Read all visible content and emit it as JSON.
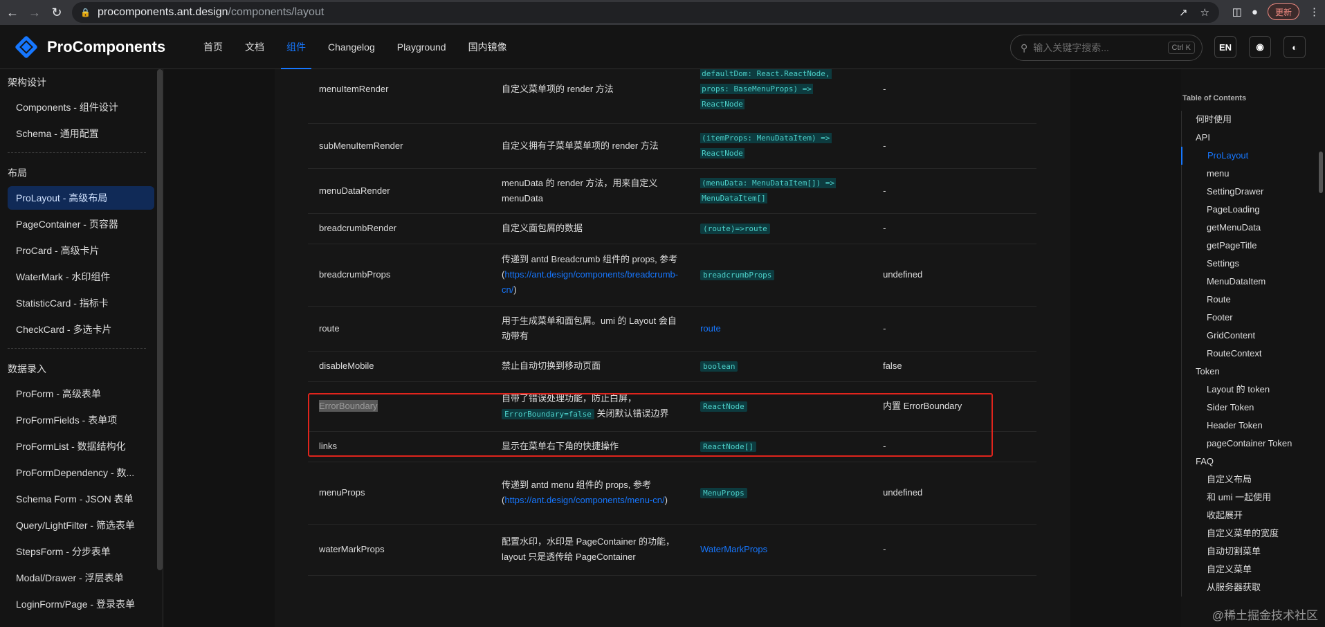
{
  "browser": {
    "url_host": "procomponents.ant.design",
    "url_path": "/components/layout",
    "update_label": "更新"
  },
  "header": {
    "logo_text": "ProComponents",
    "nav": [
      "首页",
      "文档",
      "组件",
      "Changelog",
      "Playground",
      "国内镜像"
    ],
    "active_nav": "组件",
    "search_placeholder": "输入关键字搜索...",
    "search_shortcut": "Ctrl K",
    "lang_label": "EN"
  },
  "sidebar": {
    "groups": [
      {
        "title": "架构设计",
        "items": [
          "Components - 组件设计",
          "Schema - 通用配置"
        ]
      },
      {
        "title": "布局",
        "items": [
          "ProLayout - 高级布局",
          "PageContainer - 页容器",
          "ProCard - 高级卡片",
          "WaterMark - 水印组件",
          "StatisticCard - 指标卡",
          "CheckCard - 多选卡片"
        ]
      },
      {
        "title": "数据录入",
        "items": [
          "ProForm - 高级表单",
          "ProFormFields - 表单项",
          "ProFormList - 数据结构化",
          "ProFormDependency - 数...",
          "Schema Form - JSON 表单",
          "Query/LightFilter - 筛选表单",
          "StepsForm - 分步表单",
          "Modal/Drawer - 浮层表单",
          "LoginForm/Page - 登录表单"
        ]
      }
    ],
    "active_item": "ProLayout - 高级布局"
  },
  "table": {
    "rows": [
      {
        "name": "menuItemRender",
        "desc": "自定义菜单项的 render 方法",
        "type": [
          "defaultDom: React.ReactNode,",
          "props: BaseMenuProps) =>",
          "ReactNode"
        ],
        "default": "-"
      },
      {
        "name": "subMenuItemRender",
        "desc": "自定义拥有子菜单菜单项的 render 方法",
        "type": [
          "(itemProps: MenuDataItem) =>",
          "ReactNode"
        ],
        "default": "-"
      },
      {
        "name": "menuDataRender",
        "desc": "menuData 的 render 方法，用来自定义 menuData",
        "type": [
          "(menuData: MenuDataItem[]) =>",
          "MenuDataItem[]"
        ],
        "default": "-"
      },
      {
        "name": "breadcrumbRender",
        "desc": "自定义面包屑的数据",
        "type_code": "(route)=>route",
        "default": "-"
      },
      {
        "name": "breadcrumbProps",
        "desc_pre": "传递到 antd Breadcrumb 组件的 props, 参考 (",
        "desc_link": "https://ant.design/components/breadcrumb-cn/",
        "desc_post": ")",
        "type_code": "breadcrumbProps",
        "default": "undefined"
      },
      {
        "name": "route",
        "desc": "用于生成菜单和面包屑。umi 的 Layout 会自动带有",
        "type_link": "route",
        "default": "-"
      },
      {
        "name": "disableMobile",
        "desc": "禁止自动切换到移动页面",
        "type_code": "boolean",
        "default": "false"
      },
      {
        "name": "ErrorBoundary",
        "desc_pre": "自带了错误处理功能，防止白屏，",
        "desc_code": "ErrorBoundary=false",
        "desc_post": " 关闭默认错误边界",
        "type_code": "ReactNode",
        "default": "内置 ErrorBoundary"
      },
      {
        "name": "links",
        "desc": "显示在菜单右下角的快捷操作",
        "type_code": "ReactNode[]",
        "default": "-"
      },
      {
        "name": "menuProps",
        "desc_pre": "传递到 antd menu 组件的 props, 参考 (",
        "desc_link": "https://ant.design/components/menu-cn/",
        "desc_post": ")",
        "type_code": "MenuProps",
        "default": "undefined"
      },
      {
        "name": "waterMarkProps",
        "desc": "配置水印，水印是 PageContainer 的功能，layout 只是透传给 PageContainer",
        "type_link": "WaterMarkProps",
        "default": "-"
      }
    ]
  },
  "toc": {
    "title": "Table of Contents",
    "items": [
      {
        "label": "何时使用",
        "level": 1
      },
      {
        "label": "API",
        "level": 1
      },
      {
        "label": "ProLayout",
        "level": 2,
        "active": true
      },
      {
        "label": "menu",
        "level": 2
      },
      {
        "label": "SettingDrawer",
        "level": 2
      },
      {
        "label": "PageLoading",
        "level": 2
      },
      {
        "label": "getMenuData",
        "level": 2
      },
      {
        "label": "getPageTitle",
        "level": 2
      },
      {
        "label": "Settings",
        "level": 2
      },
      {
        "label": "MenuDataItem",
        "level": 2
      },
      {
        "label": "Route",
        "level": 2
      },
      {
        "label": "Footer",
        "level": 2
      },
      {
        "label": "GridContent",
        "level": 2
      },
      {
        "label": "RouteContext",
        "level": 2
      },
      {
        "label": "Token",
        "level": 1
      },
      {
        "label": "Layout 的 token",
        "level": 2
      },
      {
        "label": "Sider Token",
        "level": 2
      },
      {
        "label": "Header Token",
        "level": 2
      },
      {
        "label": "pageContainer Token",
        "level": 2
      },
      {
        "label": "FAQ",
        "level": 1
      },
      {
        "label": "自定义布局",
        "level": 2
      },
      {
        "label": "和 umi 一起使用",
        "level": 2
      },
      {
        "label": "收起展开",
        "level": 2
      },
      {
        "label": "自定义菜单的宽度",
        "level": 2
      },
      {
        "label": "自动切割菜单",
        "level": 2
      },
      {
        "label": "自定义菜单",
        "level": 2
      },
      {
        "label": "从服务器获取",
        "level": 2
      }
    ]
  },
  "watermark": "@稀土掘金技术社区",
  "colors": {
    "accent": "#1677ff",
    "highlight_box": "#e0241c",
    "code_bg": "#0d3b3f",
    "code_fg": "#4dd0c9"
  }
}
